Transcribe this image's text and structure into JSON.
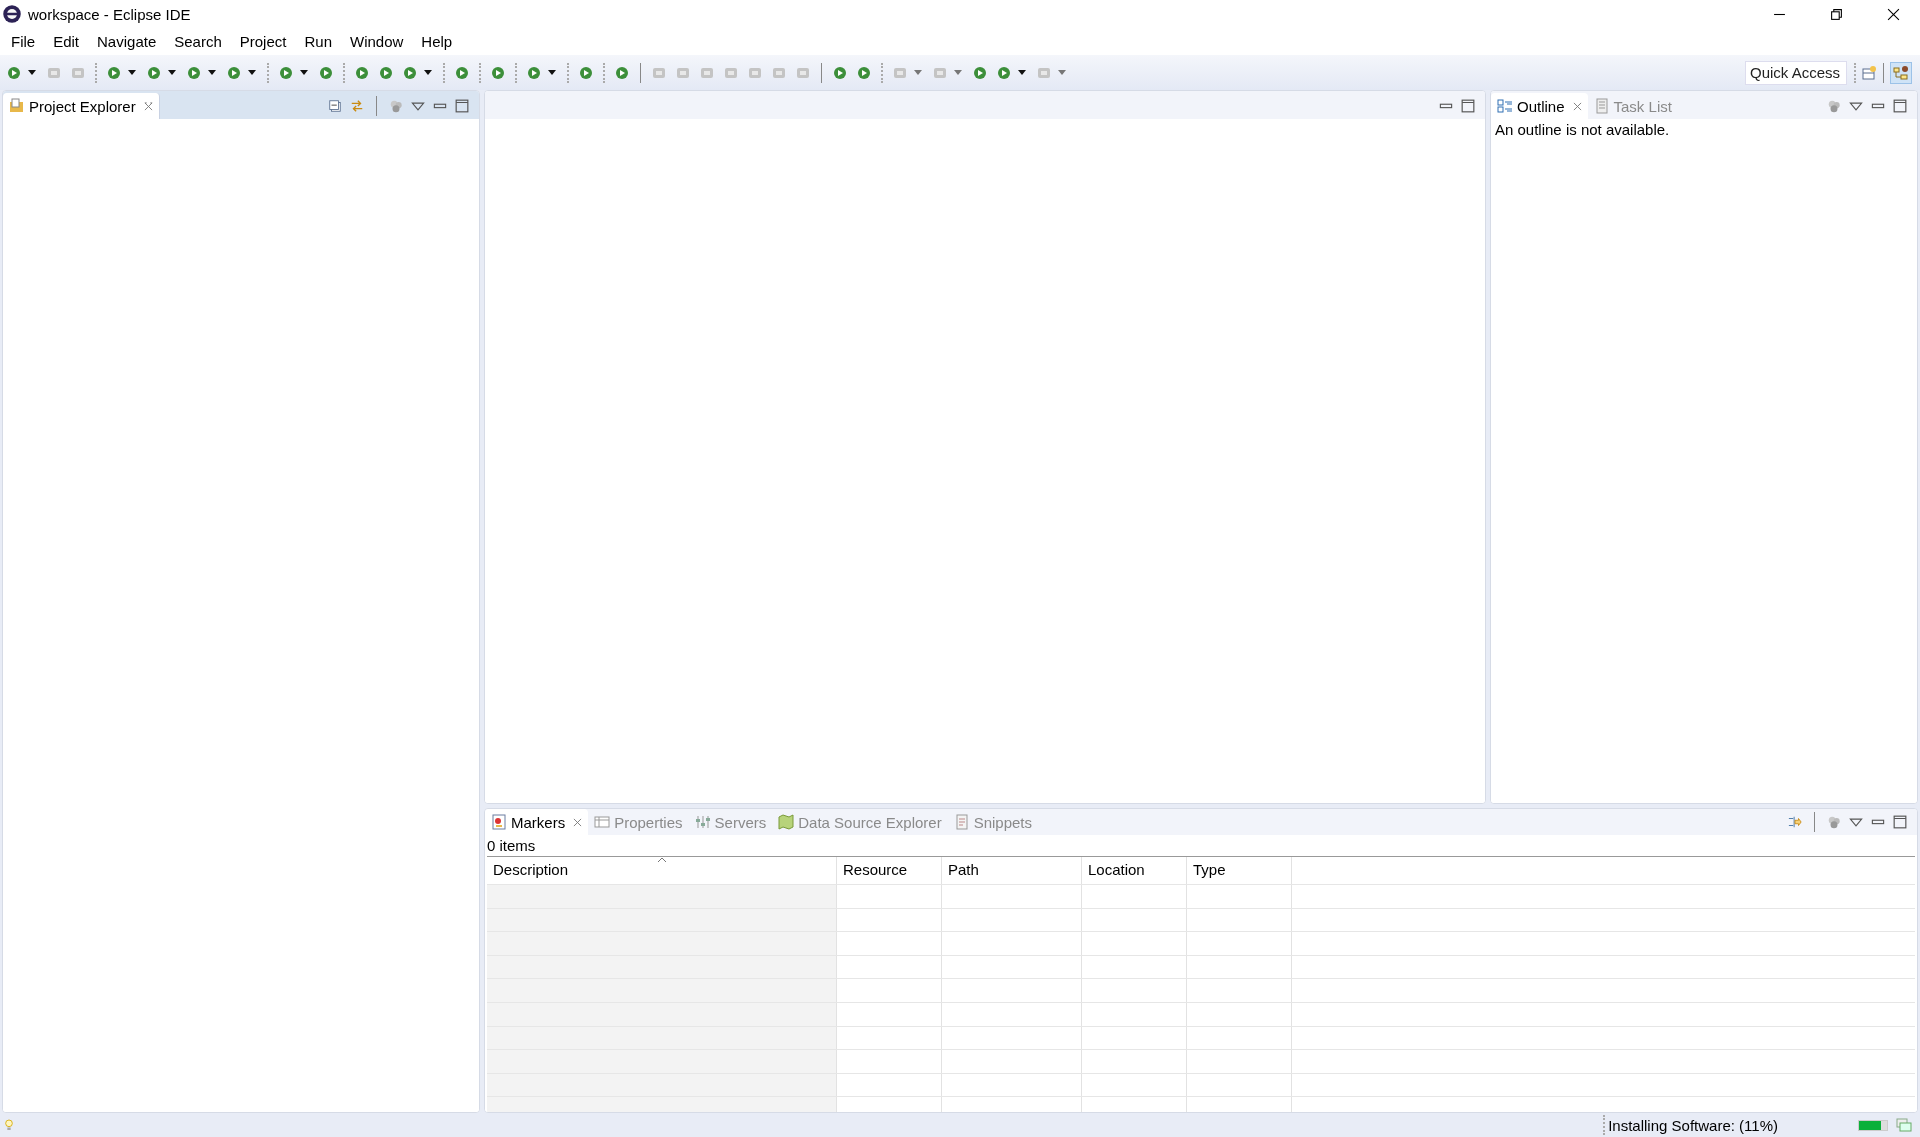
{
  "window": {
    "title": "workspace - Eclipse IDE"
  },
  "menu": [
    "File",
    "Edit",
    "Navigate",
    "Search",
    "Project",
    "Run",
    "Window",
    "Help"
  ],
  "quick_access": {
    "placeholder": "Quick Access"
  },
  "left_panel": {
    "tabs": [
      {
        "label": "Project Explorer",
        "selected": true
      }
    ]
  },
  "right_panel": {
    "tabs": [
      {
        "label": "Outline",
        "selected": true
      },
      {
        "label": "Task List",
        "selected": false
      }
    ],
    "message": "An outline is not available."
  },
  "bottom_panel": {
    "tabs": [
      {
        "label": "Markers",
        "selected": true
      },
      {
        "label": "Properties",
        "selected": false
      },
      {
        "label": "Servers",
        "selected": false
      },
      {
        "label": "Data Source Explorer",
        "selected": false
      },
      {
        "label": "Snippets",
        "selected": false
      }
    ],
    "count": "0 items",
    "columns": [
      "Description",
      "Resource",
      "Path",
      "Location",
      "Type"
    ]
  },
  "status_bar": {
    "text": "Installing Software: (11%)",
    "level": 0.8
  }
}
